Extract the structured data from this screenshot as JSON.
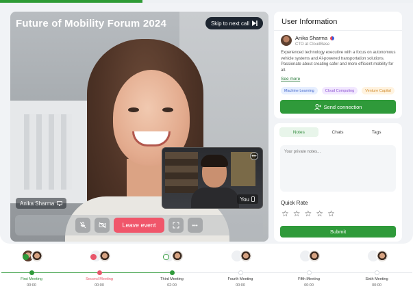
{
  "progress": {
    "fraction": 0.345
  },
  "video": {
    "title": "Future of Mobility Forum 2024",
    "skip_label": "Skip to next call",
    "speaker_name": "Anika Sharma",
    "self_label": "You",
    "leave_label": "Leave event"
  },
  "user_info": {
    "title": "User Information",
    "name": "Anika Sharma",
    "role": "CTO at CloudBase",
    "bio": "Experienced technology executive with a focus on autonomous vehicle systems and AI-powered transportation solutions. Passionate about creating safer and more efficient mobility for all.",
    "see_more": "See more",
    "tags": [
      {
        "label": "Machine Learning",
        "bg": "#e7efff",
        "fg": "#3a5fc8"
      },
      {
        "label": "Cloud Computing",
        "bg": "#f2e8ff",
        "fg": "#8a4fd0"
      },
      {
        "label": "Venture Capital",
        "bg": "#fff3e0",
        "fg": "#d08a2a"
      }
    ],
    "connect_label": "Send connection"
  },
  "notes": {
    "tabs": [
      "Notes",
      "Chats",
      "Tags"
    ],
    "active_tab": 0,
    "placeholder": "Your private notes...",
    "quick_rate_label": "Quick Rate",
    "rating": 0,
    "rating_max": 5,
    "submit_label": "Submit"
  },
  "colors": {
    "accent": "#2f9a3a",
    "danger": "#f0566a"
  },
  "timeline": {
    "completed_fraction": 0.415,
    "meetings": [
      {
        "label": "First Meeting",
        "time": "00:00",
        "state": "done"
      },
      {
        "label": "Second Meeting",
        "time": "00:00",
        "state": "missed"
      },
      {
        "label": "Third Meeting",
        "time": "02:00",
        "state": "current"
      },
      {
        "label": "Fourth Meeting",
        "time": "00:00",
        "state": "upcoming"
      },
      {
        "label": "Fifth Meeting",
        "time": "00:00",
        "state": "upcoming"
      },
      {
        "label": "Sixth Meeting",
        "time": "00:00",
        "state": "upcoming"
      }
    ]
  }
}
